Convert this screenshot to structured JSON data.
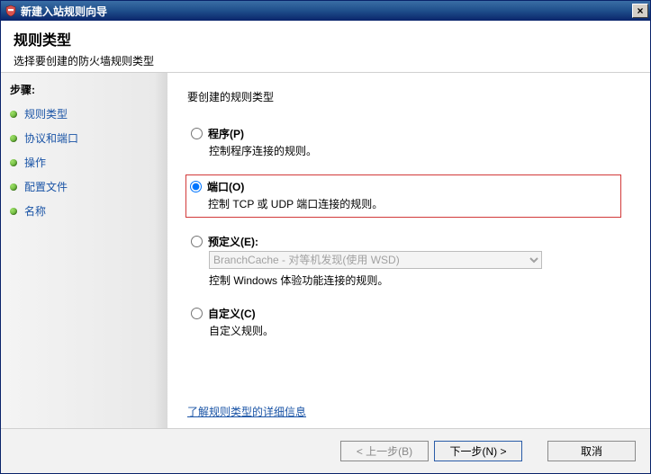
{
  "titlebar": {
    "title": "新建入站规则向导",
    "close_symbol": "×"
  },
  "header": {
    "title": "规则类型",
    "subtitle": "选择要创建的防火墙规则类型"
  },
  "sidebar": {
    "steps_label": "步骤:",
    "items": [
      {
        "label": "规则类型"
      },
      {
        "label": "协议和端口"
      },
      {
        "label": "操作"
      },
      {
        "label": "配置文件"
      },
      {
        "label": "名称"
      }
    ]
  },
  "content": {
    "prompt": "要创建的规则类型",
    "options": {
      "program": {
        "label": "程序(P)",
        "desc": "控制程序连接的规则。"
      },
      "port": {
        "label": "端口(O)",
        "desc": "控制 TCP 或 UDP 端口连接的规则。"
      },
      "predefined": {
        "label": "预定义(E):",
        "select_value": "BranchCache - 对等机发现(使用 WSD)",
        "desc": "控制 Windows 体验功能连接的规则。"
      },
      "custom": {
        "label": "自定义(C)",
        "desc": "自定义规则。"
      }
    },
    "link": "了解规则类型的详细信息"
  },
  "footer": {
    "back": "< 上一步(B)",
    "next": "下一步(N) >",
    "cancel": "取消"
  }
}
